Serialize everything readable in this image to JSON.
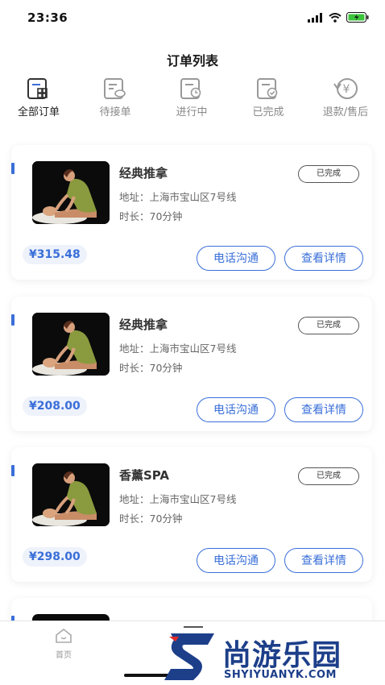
{
  "status_bar": {
    "time": "23:36"
  },
  "page_title": "订单列表",
  "tabs": [
    {
      "label": "全部订单",
      "icon": "all-orders-icon",
      "active": true
    },
    {
      "label": "待接单",
      "icon": "pending-orders-icon",
      "active": false
    },
    {
      "label": "进行中",
      "icon": "in-progress-icon",
      "active": false
    },
    {
      "label": "已完成",
      "icon": "completed-icon",
      "active": false
    },
    {
      "label": "退款/售后",
      "icon": "refund-icon",
      "active": false
    }
  ],
  "orders": [
    {
      "service": "经典推拿",
      "status": "已完成",
      "address": "地址：上海市宝山区7号线",
      "duration": "时长：70分钟",
      "price": "¥315.48",
      "call_label": "电话沟通",
      "detail_label": "查看详情"
    },
    {
      "service": "经典推拿",
      "status": "已完成",
      "address": "地址：上海市宝山区7号线",
      "duration": "时长：70分钟",
      "price": "¥208.00",
      "call_label": "电话沟通",
      "detail_label": "查看详情"
    },
    {
      "service": "香薰SPA",
      "status": "已完成",
      "address": "地址：上海市宝山区7号线",
      "duration": "时长：70分钟",
      "price": "¥298.00",
      "call_label": "电话沟通",
      "detail_label": "查看详情"
    }
  ],
  "bottom_nav": {
    "home_label": "首页"
  },
  "watermark": {
    "text": "尚游乐园",
    "url": "SHYIYUANYK.COM"
  },
  "colors": {
    "accent": "#3a6fd8",
    "price_bg": "#eef2fb",
    "watermark": "#1d3f8a",
    "watermark_red": "#e02a2a"
  }
}
